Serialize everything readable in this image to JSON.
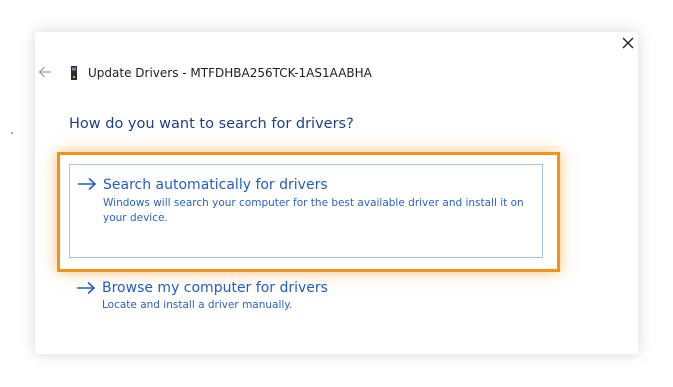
{
  "window": {
    "title": "Update Drivers - MTFDHBA256TCK-1AS1AABHA"
  },
  "icons": {
    "back": "back-arrow-icon",
    "device": "device-icon",
    "close": "close-icon",
    "option_arrow": "right-arrow-icon"
  },
  "heading": "How do you want to search for drivers?",
  "options": [
    {
      "title": "Search automatically for drivers",
      "description": "Windows will search your computer for the best available driver and install it on your device.",
      "highlighted": true
    },
    {
      "title": "Browse my computer for drivers",
      "description": "Locate and install a driver manually.",
      "highlighted": false
    }
  ],
  "colors": {
    "link_blue": "#1f5ec9",
    "heading_blue": "#1e3f8a",
    "highlight_orange": "#f2921a",
    "option_border": "#a5c6e6"
  }
}
